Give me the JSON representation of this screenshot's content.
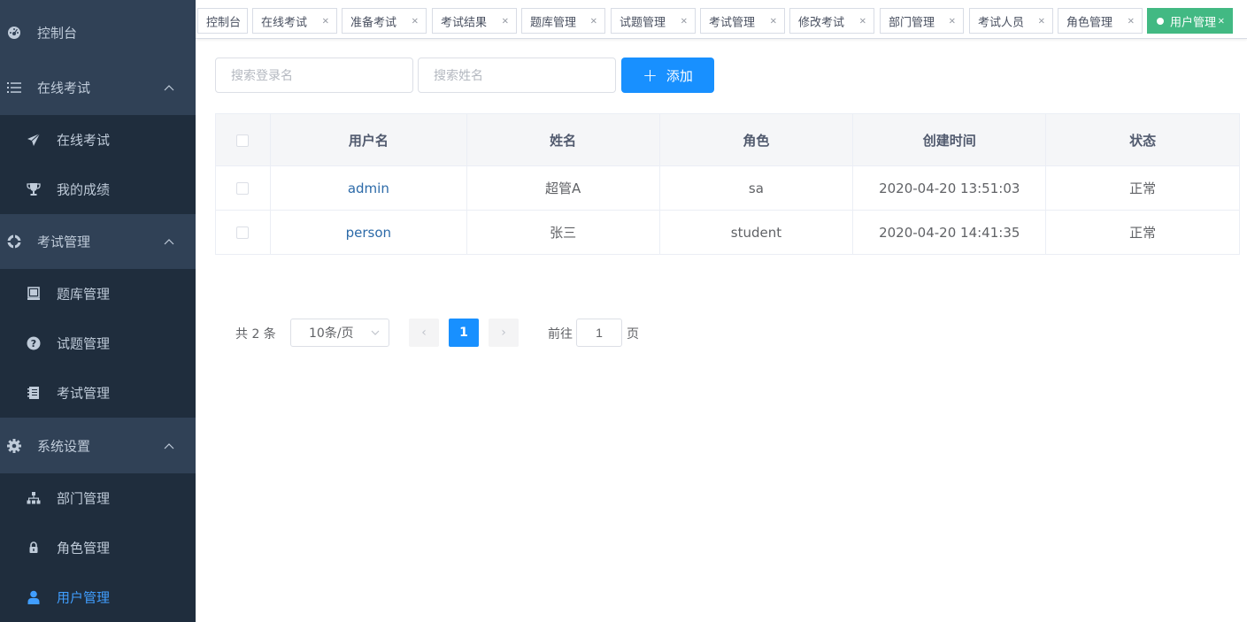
{
  "sidebar": {
    "dashboard": "控制台",
    "online_exam": {
      "label": "在线考试",
      "children": [
        "在线考试",
        "我的成绩"
      ]
    },
    "exam_mgmt": {
      "label": "考试管理",
      "children": [
        "题库管理",
        "试题管理",
        "考试管理"
      ]
    },
    "settings": {
      "label": "系统设置",
      "children": [
        "部门管理",
        "角色管理",
        "用户管理"
      ]
    }
  },
  "tags": [
    {
      "label": "控制台",
      "closable": false
    },
    {
      "label": "在线考试",
      "closable": true
    },
    {
      "label": "准备考试",
      "closable": true
    },
    {
      "label": "考试结果",
      "closable": true
    },
    {
      "label": "题库管理",
      "closable": true
    },
    {
      "label": "试题管理",
      "closable": true
    },
    {
      "label": "考试管理",
      "closable": true
    },
    {
      "label": "修改考试",
      "closable": true
    },
    {
      "label": "部门管理",
      "closable": true
    },
    {
      "label": "考试人员",
      "closable": true
    },
    {
      "label": "角色管理",
      "closable": true
    },
    {
      "label": "用户管理",
      "closable": true,
      "active": true
    }
  ],
  "tag_close": "×",
  "toolbar": {
    "search_login_placeholder": "搜索登录名",
    "search_name_placeholder": "搜索姓名",
    "add_label": "添加",
    "add_icon": "+"
  },
  "table": {
    "columns": [
      "用户名",
      "姓名",
      "角色",
      "创建时间",
      "状态"
    ],
    "rows": [
      {
        "username": "admin",
        "name": "超管A",
        "role": "sa",
        "created": "2020-04-20 13:51:03",
        "status": "正常"
      },
      {
        "username": "person",
        "name": "张三",
        "role": "student",
        "created": "2020-04-20 14:41:35",
        "status": "正常"
      }
    ]
  },
  "pagination": {
    "total": "共 2 条",
    "page_size": "10条/页",
    "prev": "‹",
    "next": "›",
    "current_page": "1",
    "goto_prefix": "前往",
    "goto_value": "1",
    "goto_suffix": "页"
  },
  "colors": {
    "sidebar_bg": "#304156",
    "submenu_bg": "#1f2d3d",
    "sidebar_text": "#bfcbd9",
    "active_menu": "#409eff",
    "active_tag": "#42b983",
    "primary": "#1890ff"
  }
}
